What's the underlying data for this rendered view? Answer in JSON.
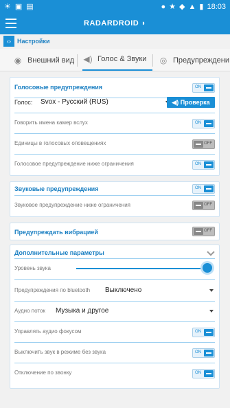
{
  "status": {
    "time": "18:03",
    "left_icons": [
      "sun-icon",
      "notification-icon",
      "clipboard-icon"
    ],
    "right_icons": [
      "location-icon",
      "star-icon",
      "wifi-icon",
      "signal-icon",
      "battery-icon"
    ]
  },
  "app": {
    "brand": "RADARDROID"
  },
  "crumb": {
    "icon_glyph": "‹›",
    "title": "Настройки"
  },
  "tabs": [
    {
      "label": "Внешний вид",
      "icon": "eye-icon"
    },
    {
      "label": "Голос & Звуки",
      "icon": "speaker-icon"
    },
    {
      "label": "Предупреждени",
      "icon": "camera-icon"
    }
  ],
  "voice": {
    "header": "Голосовые предупреждения",
    "header_toggle": "ON",
    "voice_label": "Голос:",
    "voice_value": "Svox - Русский (RUS)",
    "check_button": "Проверка",
    "rows": [
      {
        "label": "Говорить имена камер вслух",
        "toggle": "ON"
      },
      {
        "label": "Единицы в голосовых оповещениях",
        "toggle": "OFF"
      },
      {
        "label": "Голосовое предупреждение ниже ограничения",
        "toggle": "ON"
      }
    ]
  },
  "sound": {
    "header": "Звуковые предупреждения",
    "header_toggle": "ON",
    "rows": [
      {
        "label": "Звуковое предупреждение ниже ограничения",
        "toggle": "OFF"
      }
    ]
  },
  "vibration": {
    "header": "Предупреждать вибрацией",
    "toggle": "OFF"
  },
  "advanced": {
    "header": "Дополнительные параметры",
    "volume_label": "Уровень звука",
    "volume_level": 1.0,
    "bluetooth_label": "Предупреждения по bluetooth",
    "bluetooth_value": "Выключено",
    "stream_label": "Аудио поток",
    "stream_value": "Музыка и другое",
    "rows": [
      {
        "label": "Управлять аудио фокусом",
        "toggle": "ON"
      },
      {
        "label": "Выключить звук в режиме без звука",
        "toggle": "ON"
      },
      {
        "label": "Отключение по звонку",
        "toggle": "ON"
      }
    ]
  }
}
